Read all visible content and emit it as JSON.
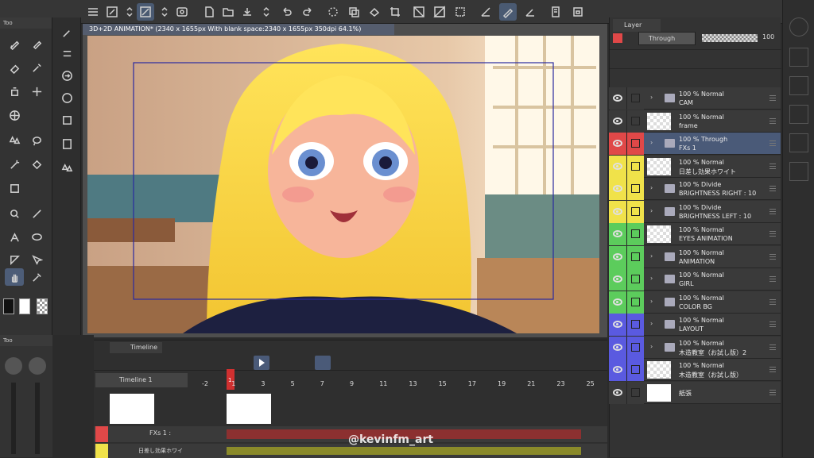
{
  "document": {
    "tab_title": "3D+2D ANIMATION* (2340 x 1655px With blank space:2340 x 1655px 350dpi 64.1%)"
  },
  "tool_panel": {
    "header": "Too"
  },
  "tool_panel_bottom": {
    "header": "Too"
  },
  "layer_panel": {
    "title": "Layer",
    "blend_mode": "Through",
    "opacity": "100",
    "layers": [
      {
        "opacity_mode": "100 % Normal",
        "name": "CAM",
        "type": "folder",
        "color": "#3a3a3a"
      },
      {
        "opacity_mode": "100 % Normal",
        "name": "frame",
        "type": "raster",
        "color": "#3a3a3a"
      },
      {
        "opacity_mode": "100 % Through",
        "name": "FXs 1",
        "type": "folder",
        "color": "#e04848",
        "selected": true
      },
      {
        "opacity_mode": "100 % Normal",
        "name": "日差し効果ホワイト",
        "type": "raster",
        "color": "#f0e24a"
      },
      {
        "opacity_mode": "100 % Divide",
        "name": "BRIGHTNESS RIGHT : 10",
        "type": "folder",
        "color": "#f0e24a"
      },
      {
        "opacity_mode": "100 % Divide",
        "name": "BRIGHTNESS LEFT : 10",
        "type": "folder",
        "color": "#f0e24a"
      },
      {
        "opacity_mode": "100 % Normal",
        "name": "EYES ANIMATION",
        "type": "raster",
        "color": "#5ccc5c"
      },
      {
        "opacity_mode": "100 % Normal",
        "name": "ANIMATION",
        "type": "folder",
        "color": "#5ccc5c"
      },
      {
        "opacity_mode": "100 % Normal",
        "name": "GIRL",
        "type": "folder",
        "color": "#5ccc5c"
      },
      {
        "opacity_mode": "100 % Normal",
        "name": "COLOR BG",
        "type": "folder",
        "color": "#5ccc5c"
      },
      {
        "opacity_mode": "100 % Normal",
        "name": "LAYOUT",
        "type": "folder",
        "color": "#5a5ae0"
      },
      {
        "opacity_mode": "100 % Normal",
        "name": "木造教室（お試し版）2",
        "type": "folder",
        "color": "#5a5ae0"
      },
      {
        "opacity_mode": "100 % Normal",
        "name": "木造教室（お試し版）",
        "type": "raster",
        "color": "#5a5ae0"
      },
      {
        "opacity_mode": "",
        "name": "紙張",
        "type": "paper",
        "color": "#3a3a3a"
      }
    ]
  },
  "timeline": {
    "title": "Timeline",
    "name": "Timeline 1",
    "frame_labels": [
      "-2",
      "1",
      "3",
      "5",
      "7",
      "9",
      "11",
      "13",
      "15",
      "17",
      "19",
      "21",
      "23",
      "25"
    ],
    "current_frame": "1",
    "tracks": [
      {
        "name": "FXs 1 :"
      },
      {
        "name": "日差し効果ホワイ"
      }
    ]
  },
  "watermark": "@kevinfm_art"
}
